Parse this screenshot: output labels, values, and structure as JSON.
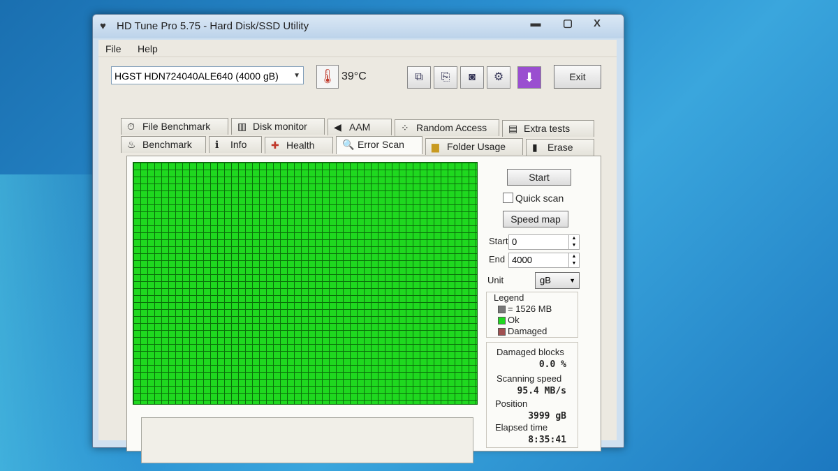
{
  "window": {
    "title": "HD Tune Pro 5.75 - Hard Disk/SSD Utility",
    "controls": {
      "minimize": "▬",
      "maximize": "▢",
      "close": "X"
    }
  },
  "menu": {
    "file": "File",
    "help": "Help"
  },
  "toolbar": {
    "drive": "HGST HDN724040ALE640 (4000 gB)",
    "temperature": "39°C",
    "exit_label": "Exit",
    "icons": [
      "copy-icon",
      "copy-text-icon",
      "camera-icon",
      "options-icon",
      "download-icon"
    ]
  },
  "tabs": {
    "row1": [
      "File Benchmark",
      "Disk monitor",
      "AAM",
      "Random Access",
      "Extra tests"
    ],
    "row2": [
      "Benchmark",
      "Info",
      "Health",
      "Error Scan",
      "Folder Usage",
      "Erase"
    ],
    "active": "Error Scan"
  },
  "error_scan": {
    "start_button": "Start",
    "quick_scan_label": "Quick scan",
    "quick_scan_checked": false,
    "speed_map_button": "Speed map",
    "start_label": "Start",
    "start_value": "0",
    "end_label": "End",
    "end_value": "4000",
    "unit_label": "Unit",
    "unit_value": "gB",
    "legend": {
      "title": "Legend",
      "block_size": "= 1526 MB",
      "ok": "Ok",
      "damaged": "Damaged"
    },
    "stats": {
      "damaged_blocks_label": "Damaged blocks",
      "damaged_blocks_value": "0.0 %",
      "scanning_speed_label": "Scanning speed",
      "scanning_speed_value": "95.4 MB/s",
      "position_label": "Position",
      "position_value": "3999 gB",
      "elapsed_label": "Elapsed time",
      "elapsed_value": "8:35:41"
    }
  },
  "colors": {
    "ok_block": "#1fd81f",
    "damaged_block": "#a05050",
    "block_size_swatch": "#777777"
  }
}
